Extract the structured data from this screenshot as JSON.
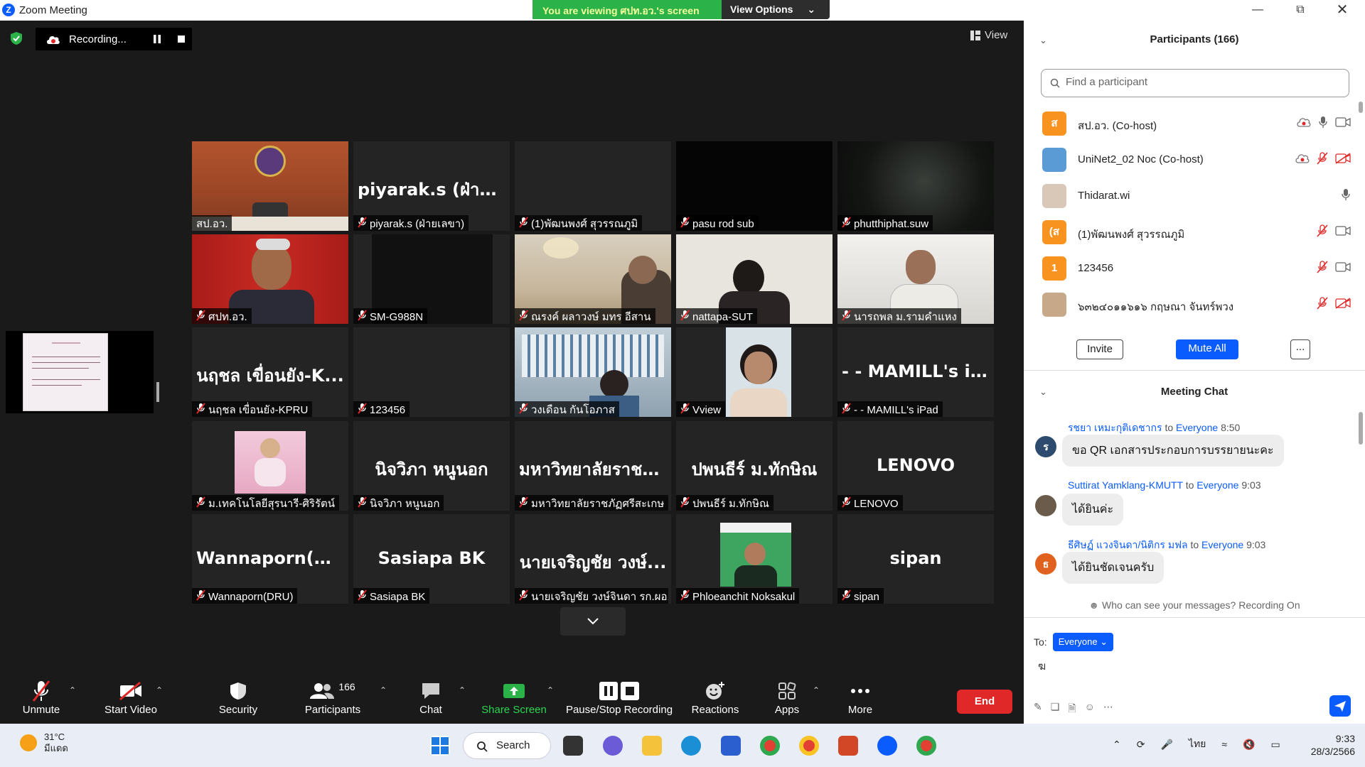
{
  "window": {
    "title": "Zoom Meeting"
  },
  "banner": {
    "message": "You are viewing ศปท.อว.'s screen",
    "options": "View Options"
  },
  "recording": {
    "label": "Recording..."
  },
  "view_label": "View",
  "tiles": [
    {
      "label": "สป.อว.",
      "bigname": "",
      "muted": false,
      "video": "room"
    },
    {
      "label": "piyarak.s (ฝ่ายเลขา)",
      "bigname": "piyarak.s (ฝ่ายเล...",
      "muted": true,
      "video": ""
    },
    {
      "label": "(1)พัฒนพงศ์ สุวรรณภูมิ",
      "bigname": "",
      "muted": true,
      "video": ""
    },
    {
      "label": "pasu rod sub",
      "bigname": "",
      "muted": true,
      "video": "black"
    },
    {
      "label": "phutthiphat.suw",
      "bigname": "",
      "muted": true,
      "video": "dark"
    },
    {
      "label": "ศปท.อว.",
      "bigname": "",
      "muted": true,
      "video": "man-red"
    },
    {
      "label": "SM-G988N",
      "bigname": "",
      "muted": true,
      "video": "black-small"
    },
    {
      "label": "ณรงค์ ผลาวงษ์ มทร อีสาน",
      "bigname": "",
      "muted": true,
      "video": "office"
    },
    {
      "label": "nattapa-SUT",
      "bigname": "",
      "muted": true,
      "video": "woman"
    },
    {
      "label": "นารถพล ม.รามคำแหง",
      "bigname": "",
      "muted": true,
      "video": "man-white"
    },
    {
      "label": "นฤชล เขื่อนยัง-KPRU",
      "bigname": "นฤชล เขื่อนยัง-K...",
      "muted": true,
      "video": ""
    },
    {
      "label": "123456",
      "bigname": "",
      "muted": true,
      "video": ""
    },
    {
      "label": "วงเดือน กันโอภาส",
      "bigname": "",
      "muted": true,
      "video": "lab"
    },
    {
      "label": "Vview",
      "bigname": "",
      "muted": true,
      "video": "portrait"
    },
    {
      "label": "- - MAMILL's iPad",
      "bigname": "- - MAMILL's i...",
      "muted": true,
      "video": ""
    },
    {
      "label": "ม.เทคโนโลยีสุรนารี-ศิริรัตน์",
      "bigname": "",
      "muted": true,
      "video": "pink"
    },
    {
      "label": "นิจวิภา หนูนอก",
      "bigname": "นิจวิภา หนูนอก",
      "muted": true,
      "video": ""
    },
    {
      "label": "มหาวิทยาลัยราชภัฏศรีสะเกษ",
      "bigname": "มหาวิทยาลัยราชภั...",
      "muted": true,
      "video": ""
    },
    {
      "label": "ปพนธีร์ ม.ทักษิณ",
      "bigname": "ปพนธีร์ ม.ทักษิณ",
      "muted": true,
      "video": ""
    },
    {
      "label": "LENOVO",
      "bigname": "LENOVO",
      "muted": true,
      "video": ""
    },
    {
      "label": "Wannaporn(DRU)",
      "bigname": "Wannaporn(DRU)",
      "muted": true,
      "video": ""
    },
    {
      "label": "Sasiapa BK",
      "bigname": "Sasiapa BK",
      "muted": true,
      "video": ""
    },
    {
      "label": "นายเจริญชัย วงษ์จินดา รก.ผอ....",
      "bigname": "นายเจริญชัย วงษ์...",
      "muted": true,
      "video": ""
    },
    {
      "label": "Phloeanchit Noksakul",
      "bigname": "",
      "muted": true,
      "video": "green"
    },
    {
      "label": "sipan",
      "bigname": "sipan",
      "muted": true,
      "video": ""
    }
  ],
  "controls": {
    "unmute": "Unmute",
    "start_video": "Start Video",
    "security": "Security",
    "participants": "Participants",
    "participants_count": "166",
    "chat": "Chat",
    "share_screen": "Share Screen",
    "pause_recording": "Pause/Stop Recording",
    "reactions": "Reactions",
    "apps": "Apps",
    "more": "More",
    "end": "End"
  },
  "participants_panel": {
    "title": "Participants (166)",
    "search_placeholder": "Find a participant",
    "list": [
      {
        "avatar": "ส",
        "name": "สป.อว. (Co-host)",
        "color": "#f7931e"
      },
      {
        "avatar": "",
        "name": "UniNet2_02 Noc (Co-host)",
        "color": "#5b9bd5"
      },
      {
        "avatar": "",
        "name": "Thidarat.wi",
        "color": "#d9c7b8"
      },
      {
        "avatar": "(ส",
        "name": "(1)พัฒนพงศ์ สุวรรณภูมิ",
        "color": "#f7931e"
      },
      {
        "avatar": "1",
        "name": "123456",
        "color": "#f7931e"
      },
      {
        "avatar": "",
        "name": "๖๓๒๔๐๑๑๖๑๖ กฤษณา จันทร์พวง",
        "color": "#c7a888"
      }
    ],
    "invite": "Invite",
    "mute_all": "Mute All",
    "more": "..."
  },
  "chat_panel": {
    "title": "Meeting Chat",
    "messages": [
      {
        "avatar": "ร",
        "sender": "รชยา เหมะกุติเดชากร",
        "to": "to",
        "recipient": "Everyone",
        "time": "8:50",
        "text": "ขอ QR เอกสารประกอบการบรรยายนะคะ",
        "color": "#2d4b6e"
      },
      {
        "avatar": "",
        "sender": "Suttirat Yamklang-KMUTT",
        "to": "to",
        "recipient": "Everyone",
        "time": "9:03",
        "text": "ได้ยินค่ะ",
        "color": "#6b5b4a"
      },
      {
        "avatar": "ธ",
        "sender": "ธีศิษฏ์ แวงจินดา/นิติกร มฟล",
        "to": "to",
        "recipient": "Everyone",
        "time": "9:03",
        "text": "ได้ยินชัดเจนครับ",
        "color": "#e0621e"
      }
    ],
    "who_can_see": "Who can see your messages? Recording On",
    "to_label": "To:",
    "to_value": "Everyone",
    "draft": "ฆ"
  },
  "taskbar": {
    "temp": "31°C",
    "weather": "มีแดด",
    "search": "Search",
    "lang": "ไทย",
    "time": "9:33",
    "date": "28/3/2566"
  }
}
